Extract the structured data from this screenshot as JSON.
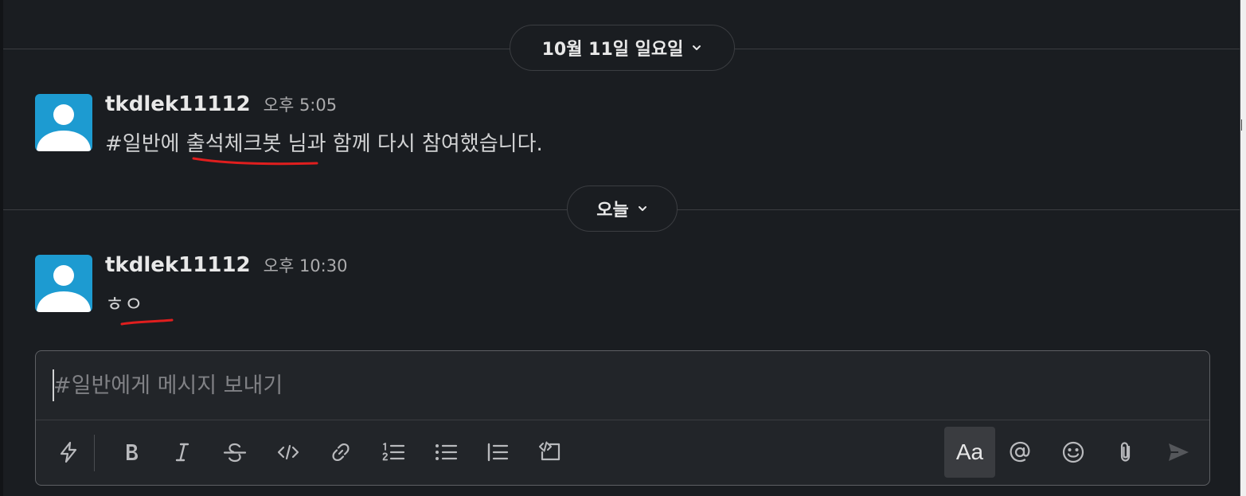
{
  "date_dividers": [
    {
      "label": "10월 11일 일요일"
    },
    {
      "label": "오늘"
    }
  ],
  "messages": [
    {
      "author": "tkdlek11112",
      "time": "오후 5:05",
      "text": "#일반에 출석체크봇 님과 함께 다시 참여했습니다."
    },
    {
      "author": "tkdlek11112",
      "time": "오후 10:30",
      "text": "ㅎㅇ"
    }
  ],
  "composer": {
    "placeholder": "#일반에게 메시지 보내기",
    "format_toggle_label": "Aa"
  },
  "toolbar": {
    "icons": [
      "shortcuts-lightning-icon",
      "bold-icon",
      "italic-icon",
      "strikethrough-icon",
      "code-icon",
      "link-icon",
      "numbered-list-icon",
      "bulleted-list-icon",
      "blockquote-icon",
      "code-block-icon",
      "format-toggle-icon",
      "mention-icon",
      "emoji-icon",
      "attach-icon",
      "send-icon"
    ]
  },
  "colors": {
    "background": "#1a1d21",
    "avatar": "#1d9bd1",
    "annotation": "#e01e1e"
  }
}
